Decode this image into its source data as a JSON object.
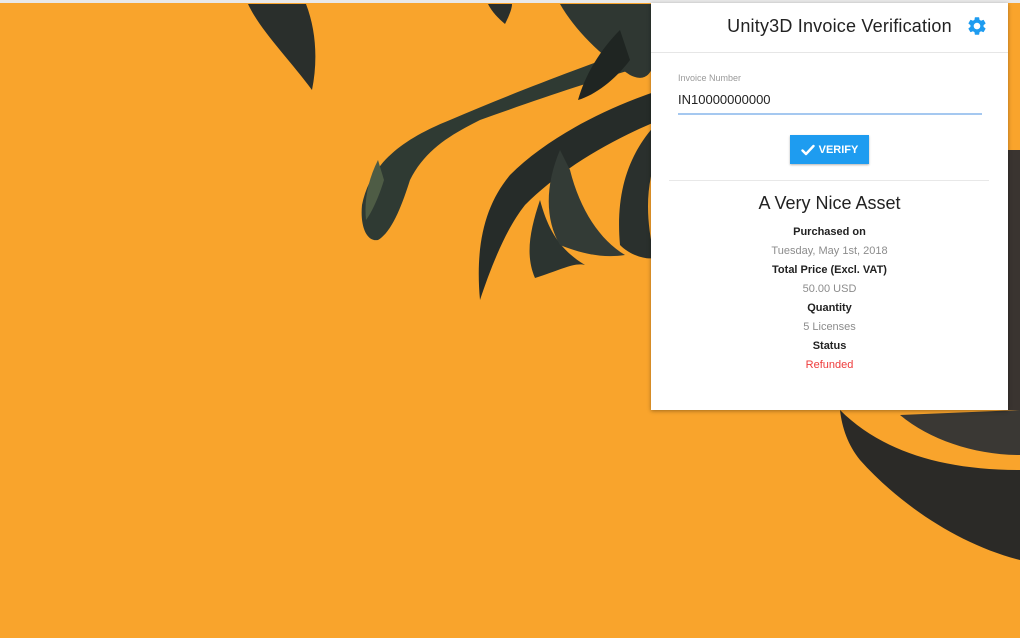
{
  "popup": {
    "title": "Unity3D Invoice Verification",
    "settings_icon": "gear-icon",
    "invoice_field": {
      "label": "Invoice Number",
      "value": "IN10000000000"
    },
    "verify_button": {
      "label": "VERIFY",
      "icon": "check-icon"
    },
    "result": {
      "asset_name": "A Very Nice Asset",
      "purchased_on_label": "Purchased on",
      "purchased_on_value": "Tuesday, May 1st, 2018",
      "total_price_label": "Total Price (Excl. VAT)",
      "total_price_value": "50.00 USD",
      "quantity_label": "Quantity",
      "quantity_value": "5 Licenses",
      "status_label": "Status",
      "status_value": "Refunded"
    }
  },
  "colors": {
    "background": "#f9a42c",
    "accent": "#1e9cf0",
    "status_refunded": "#ee3b3b",
    "input_underline": "#a5c8f0"
  }
}
